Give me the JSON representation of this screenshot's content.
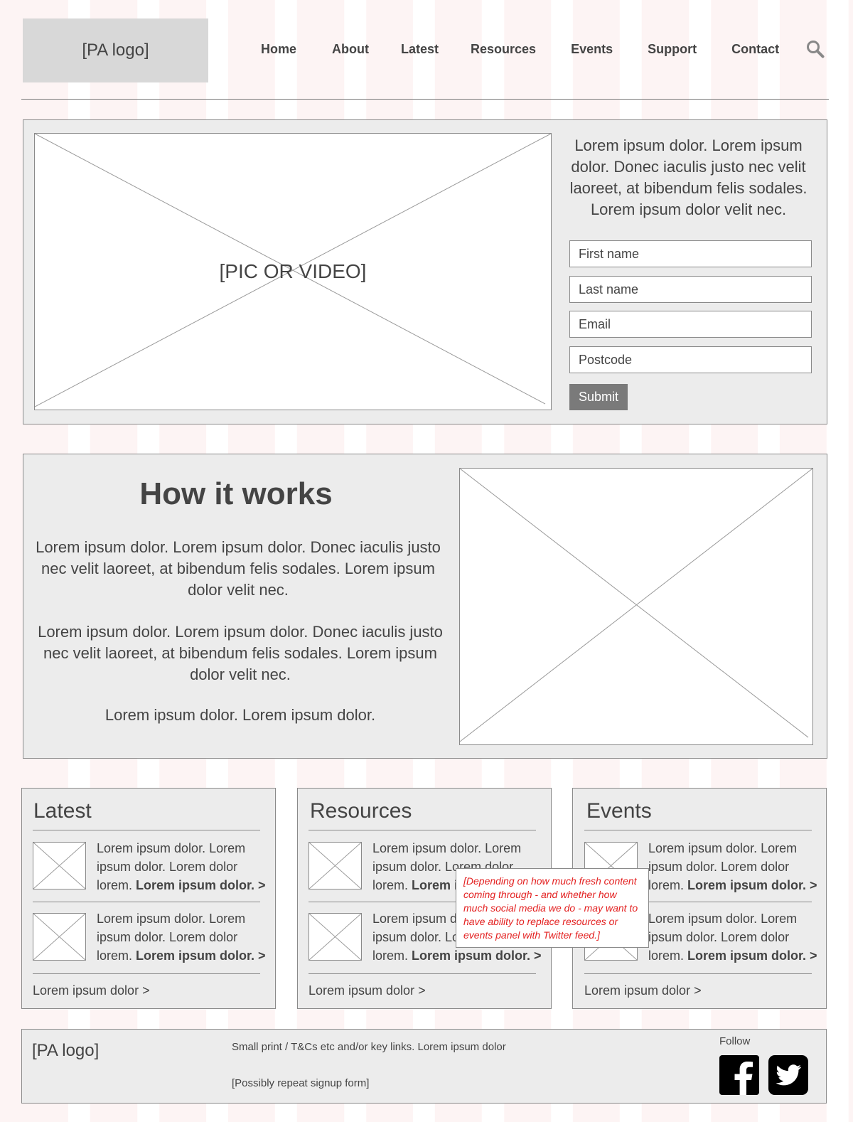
{
  "header": {
    "logo": "[PA logo]",
    "nav": [
      "Home",
      "About",
      "Latest",
      "Resources",
      "Events",
      "Support",
      "Contact"
    ],
    "search_icon": "search-icon"
  },
  "hero": {
    "media_label": "[PIC OR VIDEO]",
    "text": "Lorem ipsum dolor. Lorem ipsum dolor. Donec iaculis justo nec velit laoreet, at bibendum felis sodales. Lorem ipsum dolor velit nec.",
    "form": {
      "first_name": "First name",
      "last_name": "Last name",
      "email": "Email",
      "postcode": "Postcode",
      "submit": "Submit"
    }
  },
  "how_it_works": {
    "title": "How it works",
    "p1": "Lorem ipsum dolor. Lorem ipsum dolor. Donec iaculis justo nec velit laoreet, at bibendum felis sodales. Lorem ipsum dolor velit nec.",
    "p2": "Lorem ipsum dolor. Lorem ipsum dolor. Donec iaculis justo nec velit laoreet, at bibendum felis sodales. Lorem ipsum dolor velit nec.",
    "p3": "Lorem ipsum dolor. Lorem ipsum dolor."
  },
  "cards": [
    {
      "title": "Latest",
      "items": [
        {
          "text": "Lorem ipsum dolor. Lorem ipsum dolor. Lorem dolor lorem.",
          "link": "Lorem ipsum dolor. >"
        },
        {
          "text": "Lorem ipsum dolor. Lorem ipsum dolor. Lorem dolor lorem.",
          "link": "Lorem ipsum dolor. >"
        }
      ],
      "more": "Lorem ipsum dolor >"
    },
    {
      "title": "Resources",
      "items": [
        {
          "text": "Lorem ipsum dolor. Lorem ipsum dolor. Lorem dolor lorem.",
          "link": "Lorem ipsum dolor. >"
        },
        {
          "text": "Lorem ipsum dolor. Lorem ipsum dolor. Lorem dolor lorem.",
          "link": "Lorem ipsum dolor. >"
        }
      ],
      "more": "Lorem ipsum dolor >"
    },
    {
      "title": "Events",
      "items": [
        {
          "text": "Lorem ipsum dolor. Lorem ipsum dolor. Lorem dolor lorem.",
          "link": "Lorem ipsum dolor. >"
        },
        {
          "text": "Lorem ipsum dolor. Lorem ipsum dolor. Lorem dolor lorem.",
          "link": "Lorem ipsum dolor. >"
        }
      ],
      "more": "Lorem ipsum dolor >"
    }
  ],
  "note": "[Depending on how much fresh content coming through - and whether how much social media we do - may want to have ability to replace resources or events panel with Twitter feed.]",
  "footer": {
    "logo": "[PA logo]",
    "small_print": "Small print / T&Cs etc and/or key links. Lorem ipsum dolor",
    "signup_note": "[Possibly repeat signup form]",
    "follow": "Follow",
    "social_icons": [
      "facebook-icon",
      "twitter-icon"
    ]
  },
  "colors": {
    "panel_bg": "#ececec",
    "border": "#8a8a8a",
    "text": "#444444",
    "button_bg": "#7a7a7a",
    "note_text": "#e32020",
    "stripe": "#fdf4f4"
  }
}
